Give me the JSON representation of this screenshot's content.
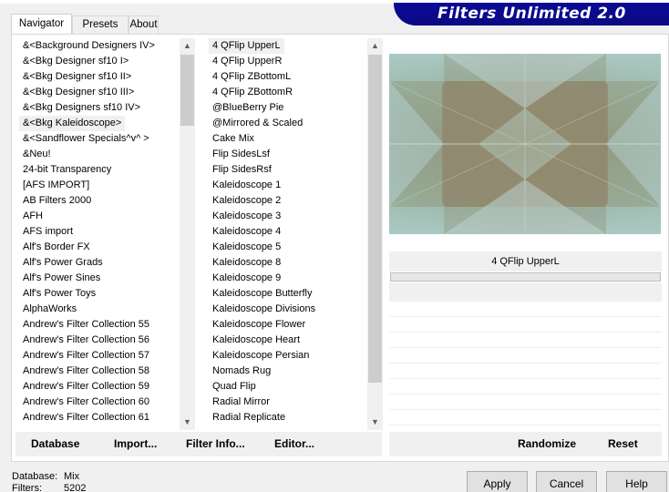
{
  "tabs": [
    "Navigator",
    "Presets",
    "About"
  ],
  "banner_title": "Filters Unlimited 2.0",
  "categories": [
    "&<Background Designers IV>",
    "&<Bkg Designer sf10 I>",
    "&<Bkg Designer sf10 II>",
    "&<Bkg Designer sf10 III>",
    "&<Bkg Designers sf10 IV>",
    "&<Bkg Kaleidoscope>",
    "&<Sandflower Specials^v^ >",
    "&Neu!",
    "24-bit Transparency",
    "[AFS IMPORT]",
    "AB Filters 2000",
    "AFH",
    "AFS import",
    "Alf's Border FX",
    "Alf's Power Grads",
    "Alf's Power Sines",
    "Alf's Power Toys",
    "AlphaWorks",
    "Andrew's Filter Collection 55",
    "Andrew's Filter Collection 56",
    "Andrew's Filter Collection 57",
    "Andrew's Filter Collection 58",
    "Andrew's Filter Collection 59",
    "Andrew's Filter Collection 60",
    "Andrew's Filter Collection 61"
  ],
  "selected_category_index": 5,
  "filters": [
    "4 QFlip UpperL",
    "4 QFlip UpperR",
    "4 QFlip ZBottomL",
    "4 QFlip ZBottomR",
    "@BlueBerry Pie",
    "@Mirrored & Scaled",
    "Cake Mix",
    "Flip SidesLsf",
    "Flip SidesRsf",
    "Kaleidoscope 1",
    "Kaleidoscope 2",
    "Kaleidoscope 3",
    "Kaleidoscope 4",
    "Kaleidoscope 5",
    "Kaleidoscope 8",
    "Kaleidoscope 9",
    "Kaleidoscope Butterfly",
    "Kaleidoscope Divisions",
    "Kaleidoscope Flower",
    "Kaleidoscope Heart",
    "Kaleidoscope Persian",
    "Nomads Rug",
    "Quad Flip",
    "Radial Mirror",
    "Radial Replicate"
  ],
  "selected_filter_index": 0,
  "selected_filter_name": "4 QFlip UpperL",
  "progress_fraction": 0,
  "buttons": {
    "database": "Database",
    "import": "Import...",
    "filter_info": "Filter Info...",
    "editor": "Editor...",
    "randomize": "Randomize",
    "reset": "Reset",
    "apply": "Apply",
    "cancel": "Cancel",
    "help": "Help"
  },
  "footer": {
    "database_label": "Database:",
    "database_value": "Mix",
    "filters_label": "Filters:",
    "filters_value": "5202"
  },
  "icons": {
    "scroll_up": "▲",
    "scroll_down": "▼"
  },
  "colors": {
    "banner_bg": "#0b0a8c",
    "window_bg": "#f0f0f0",
    "panel_bg": "#ffffff"
  }
}
